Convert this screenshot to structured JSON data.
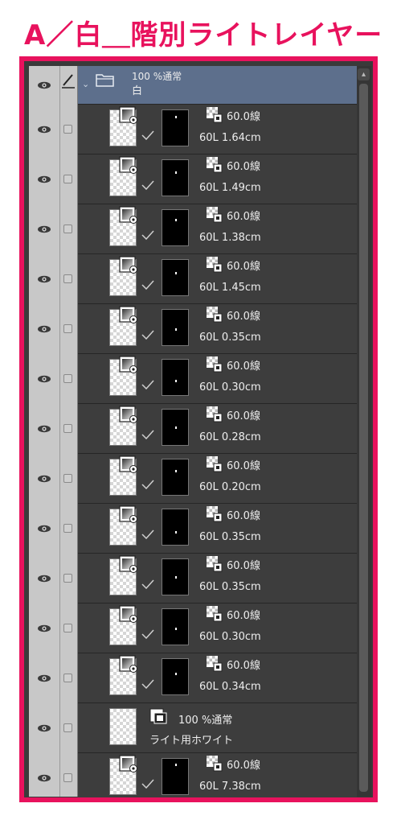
{
  "title": "A／白＿階別ライトレイヤー",
  "folder": {
    "mode": "100 %通常",
    "name": "白"
  },
  "layers": [
    {
      "type": "vector",
      "opacity": "60.0線",
      "name": "60L 1.64cm",
      "mask_dot_pct": 0.18
    },
    {
      "type": "vector",
      "opacity": "60.0線",
      "name": "60L 1.49cm",
      "mask_dot_pct": 0.38
    },
    {
      "type": "vector",
      "opacity": "60.0線",
      "name": "60L 1.38cm",
      "mask_dot_pct": 0.3
    },
    {
      "type": "vector",
      "opacity": "60.0線",
      "name": "60L 1.45cm",
      "mask_dot_pct": 0.4
    },
    {
      "type": "vector",
      "opacity": "60.0線",
      "name": "60L 0.35cm",
      "mask_dot_pct": 0.6
    },
    {
      "type": "vector",
      "opacity": "60.0線",
      "name": "60L 0.30cm",
      "mask_dot_pct": 0.65
    },
    {
      "type": "vector",
      "opacity": "60.0線",
      "name": "60L 0.28cm",
      "mask_dot_pct": 0.55
    },
    {
      "type": "vector",
      "opacity": "60.0線",
      "name": "60L 0.20cm",
      "mask_dot_pct": 0.35
    },
    {
      "type": "vector",
      "opacity": "60.0線",
      "name": "60L 0.35cm",
      "mask_dot_pct": 0.7
    },
    {
      "type": "vector",
      "opacity": "60.0線",
      "name": "60L 0.35cm",
      "mask_dot_pct": 0.55
    },
    {
      "type": "vector",
      "opacity": "60.0線",
      "name": "60L 0.30cm",
      "mask_dot_pct": 0.6
    },
    {
      "type": "vector",
      "opacity": "60.0線",
      "name": "60L 0.34cm",
      "mask_dot_pct": 0.45
    },
    {
      "type": "raster",
      "mode": "100 %通常",
      "name": "ライト用ホワイト"
    },
    {
      "type": "vector",
      "opacity": "60.0線",
      "name": "60L 7.38cm",
      "mask_dot_pct": 0.15
    }
  ],
  "icons": {
    "eye": "eye-icon",
    "pen": "pen-icon",
    "folder": "folder-icon",
    "vector": "vector-layer-icon",
    "mask": "layer-mask-icon",
    "check": "check-icon"
  },
  "colors": {
    "accent": "#e8125d",
    "folder_row": "#5d6f8c",
    "layer_row": "#3d3d3d"
  }
}
